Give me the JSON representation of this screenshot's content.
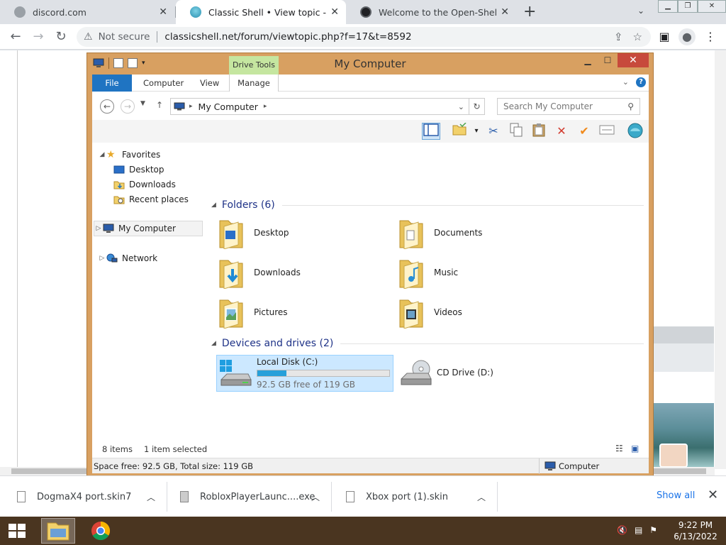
{
  "browser": {
    "tabs": [
      {
        "title": "discord.com",
        "active": false
      },
      {
        "title": "Classic Shell • View topic - Dogm",
        "active": true
      },
      {
        "title": "Welcome to the Open-Shell-Men",
        "active": false
      }
    ],
    "address": {
      "security_label": "Not secure",
      "url": "classicshell.net/forum/viewtopic.php?f=17&t=8592"
    }
  },
  "explorer": {
    "title": "My Computer",
    "contextual_tab": "Drive Tools",
    "ribbon_tabs": [
      "File",
      "Computer",
      "View",
      "Manage"
    ],
    "address_path": "My Computer",
    "search_placeholder": "Search My Computer",
    "nav": {
      "favorites_label": "Favorites",
      "favorites": [
        "Desktop",
        "Downloads",
        "Recent places"
      ],
      "my_computer": "My Computer",
      "network": "Network"
    },
    "folders_header": "Folders (6)",
    "folders": [
      {
        "name": "Desktop",
        "icon": "desktop-folder-icon"
      },
      {
        "name": "Documents",
        "icon": "documents-folder-icon"
      },
      {
        "name": "Downloads",
        "icon": "downloads-folder-icon"
      },
      {
        "name": "Music",
        "icon": "music-folder-icon"
      },
      {
        "name": "Pictures",
        "icon": "pictures-folder-icon"
      },
      {
        "name": "Videos",
        "icon": "videos-folder-icon"
      }
    ],
    "devices_header": "Devices and drives (2)",
    "drives": [
      {
        "name": "Local Disk (C:)",
        "free_text": "92.5 GB free of 119 GB",
        "used_fraction": 0.22,
        "selected": true
      },
      {
        "name": "CD Drive (D:)",
        "selected": false
      }
    ],
    "status": {
      "items": "8 items",
      "selected": "1 item selected",
      "space": "Space free: 92.5 GB, Total size: 119 GB",
      "location": "Computer"
    }
  },
  "downloads": {
    "items": [
      "DogmaX4 port.skin7",
      "RobloxPlayerLaunc....exe",
      "Xbox port (1).skin"
    ],
    "show_all": "Show all"
  },
  "taskbar": {
    "time": "9:22 PM",
    "date": "6/13/2022"
  },
  "colors": {
    "explorer_frame": "#d8a061",
    "file_tab": "#1f74c2",
    "taskbar": "#4a3520",
    "disk_fill": "#26a0da"
  }
}
